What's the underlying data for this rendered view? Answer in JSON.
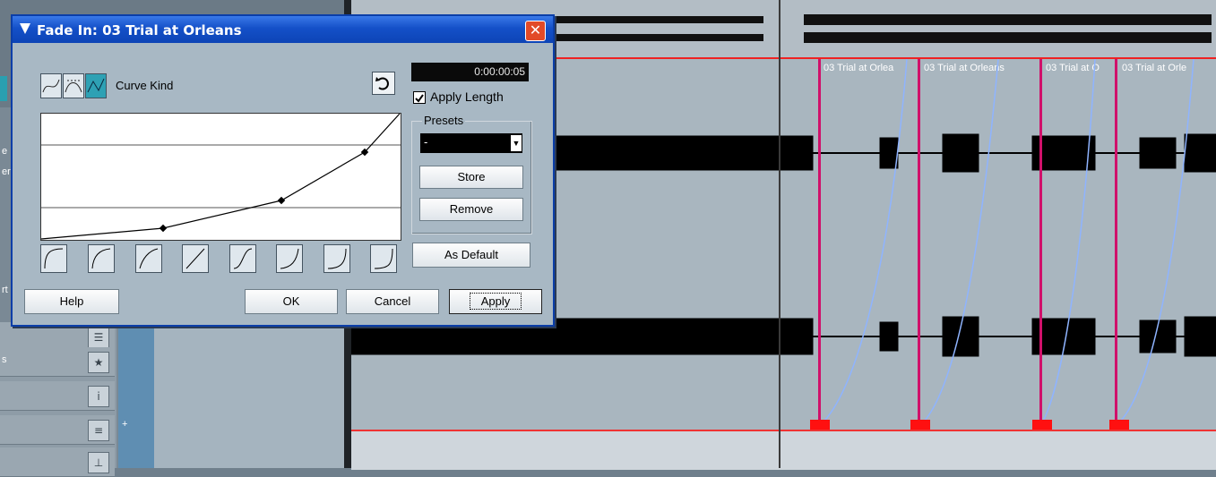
{
  "dialog": {
    "title": "Fade In: 03 Trial at Orleans",
    "curve_kind_label": "Curve Kind",
    "time_value": "0:00:00:05",
    "apply_length_label": "Apply Length",
    "apply_length_checked": true,
    "presets_label": "Presets",
    "preset_selected": "-",
    "store_label": "Store",
    "remove_label": "Remove",
    "as_default_label": "As Default",
    "help_label": "Help",
    "ok_label": "OK",
    "cancel_label": "Cancel",
    "apply_label": "Apply",
    "curve_kind_buttons": [
      "spline-icon",
      "damped-spline-icon",
      "linear-icon"
    ],
    "curve_kind_active": "linear-icon",
    "curve_presets": [
      "curve-preset-1",
      "curve-preset-2",
      "curve-preset-3",
      "curve-preset-4",
      "curve-preset-5",
      "curve-preset-6",
      "curve-preset-7",
      "curve-preset-8"
    ]
  },
  "arrange": {
    "clip_names": [
      "03 Trial at Orlea",
      "03 Trial at Orleans",
      "03 Trial at O",
      "03 Trial at Orle"
    ]
  },
  "track_panel": {
    "fragments": [
      "e",
      "er",
      "rt",
      "s"
    ]
  },
  "colors": {
    "title_blue": "#1450c8",
    "close_red": "#e24a28",
    "fade_marker": "#d0106a",
    "waveform": "#000000",
    "fade_curve": "#8fb4ff"
  }
}
